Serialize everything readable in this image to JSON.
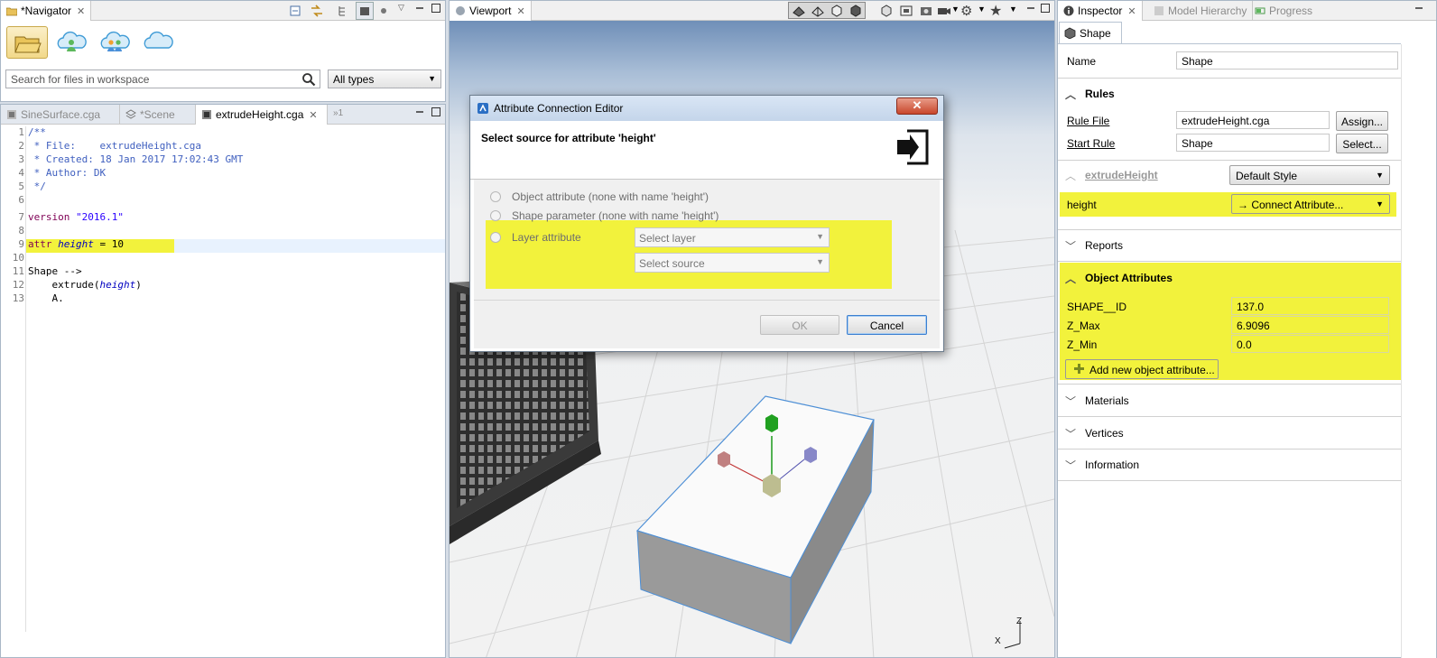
{
  "navigator": {
    "tab_label": "*Navigator",
    "search_placeholder": "Search for files in workspace",
    "type_filter": "All types"
  },
  "editor": {
    "tabs": [
      {
        "label": "SineSurface.cga"
      },
      {
        "label": "*Scene"
      },
      {
        "label": "extrudeHeight.cga"
      },
      {
        "label": "1"
      }
    ],
    "overflow_marker": "»",
    "line_numbers": [
      "1",
      "2",
      "3",
      "4",
      "5",
      "6",
      "7",
      "8",
      "9",
      "10",
      "11",
      "12",
      "13"
    ],
    "lines": {
      "l1": "/**",
      "l2": " * File:    extrudeHeight.cga",
      "l3": " * Created: 18 Jan 2017 17:02:43 GMT",
      "l4": " * Author: DK",
      "l5": " */",
      "l7_kw": "version",
      "l7_str": "\"2016.1\"",
      "l9_kw": "attr",
      "l9_name": "height",
      "l9_rest": " = 10",
      "l11": "Shape -->",
      "l12_a": "    extrude(",
      "l12_b": "height",
      "l12_c": ")",
      "l13": "    A."
    }
  },
  "viewport": {
    "tab_label": "Viewport",
    "axes": {
      "x": "X",
      "z": "Z"
    }
  },
  "dialog": {
    "title": "Attribute Connection Editor",
    "heading": "Select source for attribute 'height'",
    "close_glyph": "✕",
    "options": [
      {
        "label": "Object attribute (none with name 'height')"
      },
      {
        "label": "Shape parameter (none with name 'height')"
      },
      {
        "label": "Layer attribute"
      }
    ],
    "select_layer": "Select layer",
    "select_source": "Select source",
    "ok": "OK",
    "cancel": "Cancel"
  },
  "inspector": {
    "tabs": [
      {
        "label": "Inspector"
      },
      {
        "label": "Model Hierarchy"
      },
      {
        "label": "Progress"
      }
    ],
    "subtab": "Shape",
    "name_label": "Name",
    "name_value": "Shape",
    "rules": {
      "title": "Rules",
      "rule_file_label": "Rule File",
      "rule_file_value": "extrudeHeight.cga",
      "assign": "Assign...",
      "start_rule_label": "Start Rule",
      "start_rule_value": "Shape",
      "select": "Select..."
    },
    "extrude": {
      "title": "extrudeHeight",
      "style": "Default Style",
      "attr_label": "height",
      "attr_value": "→ Connect Attribute..."
    },
    "reports": "Reports",
    "object_attributes": {
      "title": "Object Attributes",
      "rows": [
        {
          "label": "SHAPE__ID",
          "value": "137.0"
        },
        {
          "label": "Z_Max",
          "value": "6.9096"
        },
        {
          "label": "Z_Min",
          "value": "0.0"
        }
      ],
      "add_button": "Add new object attribute..."
    },
    "materials": "Materials",
    "vertices": "Vertices",
    "information": "Information"
  },
  "colors": {
    "highlight": "#f2f23c",
    "accent": "#3c7fd0",
    "close": "#c8472c"
  }
}
